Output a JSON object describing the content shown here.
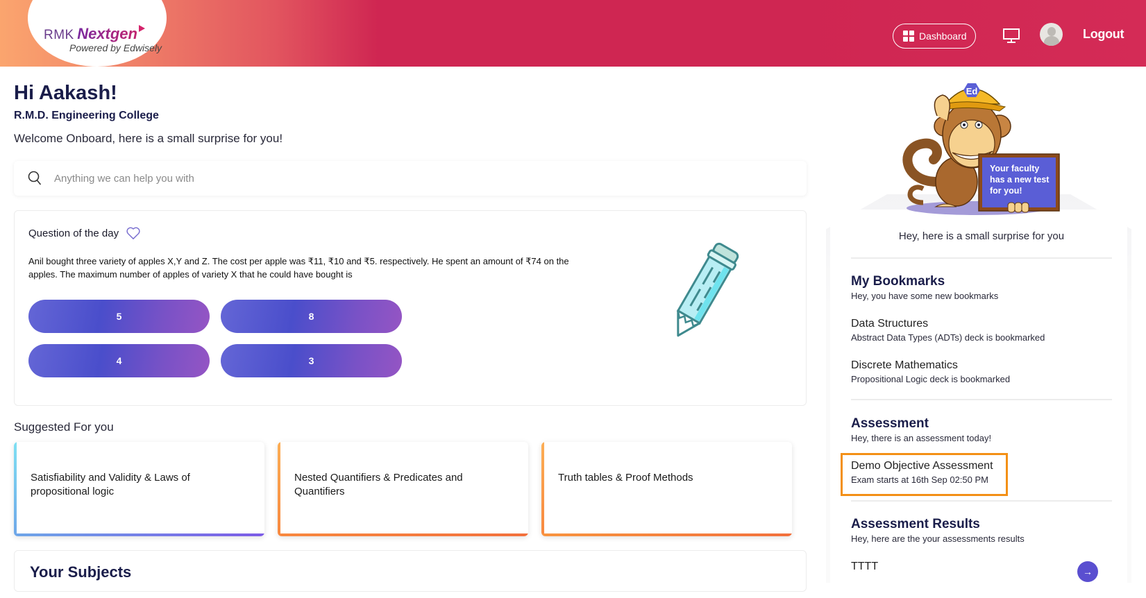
{
  "header": {
    "logo": {
      "brand_prefix": "RMK",
      "brand_name": "Nextgen",
      "tagline": "Powered by Edwisely"
    },
    "dashboard_label": "Dashboard",
    "monitor_icon": "monitor-icon",
    "avatar_icon": "user-avatar-icon",
    "logout_label": "Logout",
    "colors": {
      "gradient_start": "#fba56e",
      "gradient_end": "#cf2652"
    }
  },
  "greeting": {
    "title": "Hi Aakash!",
    "college": "R.M.D. Engineering College",
    "welcome": "Welcome Onboard, here is a small surprise for you!"
  },
  "search": {
    "placeholder": "Anything we can help you with",
    "value": ""
  },
  "question_of_day": {
    "title": "Question of the day",
    "question": "Anil bought three variety of apples X,Y and Z. The cost per apple was ₹11, ₹10 and ₹5. respectively. He spent an amount of ₹74 on the apples. The maximum number of apples of variety X that he could have bought is",
    "options": [
      "5",
      "8",
      "4",
      "3"
    ]
  },
  "suggested": {
    "title": "Suggested For you",
    "cards": [
      {
        "label": "Satisfiability and Validity & Laws of propositional logic"
      },
      {
        "label": "Nested Quantifiers & Predicates and Quantifiers"
      },
      {
        "label": "Truth tables & Proof Methods"
      }
    ]
  },
  "subjects": {
    "title": "Your Subjects"
  },
  "right_panel": {
    "board_text": "Your faculty has a new test for you!",
    "surprise": "Hey, here is a small surprise for you",
    "bookmarks": {
      "title": "My Bookmarks",
      "subtitle": "Hey, you have some new bookmarks",
      "items": [
        {
          "title": "Data Structures",
          "subtitle": "Abstract Data Types (ADTs) deck is bookmarked"
        },
        {
          "title": "Discrete Mathematics",
          "subtitle": "Propositional Logic deck is bookmarked"
        }
      ]
    },
    "assessment": {
      "title": "Assessment",
      "subtitle": "Hey, there is an assessment today!",
      "item": {
        "title": "Demo Objective Assessment",
        "subtitle": "Exam starts at 16th Sep 02:50 PM"
      },
      "highlight_color": "#f39016"
    },
    "results": {
      "title": "Assessment Results",
      "subtitle": "Hey, here are the your assessments results",
      "items": [
        {
          "title": "TTTT"
        }
      ]
    }
  }
}
